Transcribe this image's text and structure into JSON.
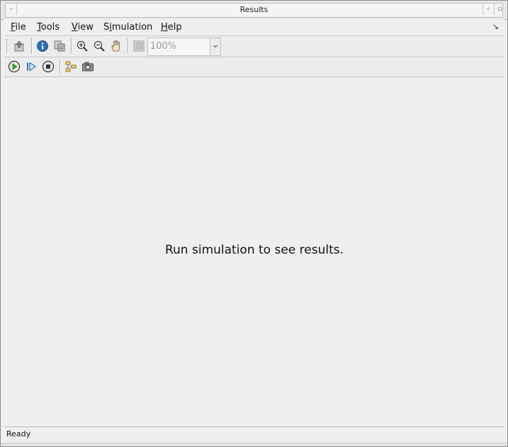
{
  "window": {
    "title": "Results",
    "controls": {
      "menu_icon": "window-menu-icon",
      "shade_icon": "shade-icon",
      "maximize_icon": "maximize-icon"
    }
  },
  "menubar": {
    "items": [
      {
        "label": "File",
        "mnemonic": "F",
        "rest": "ile"
      },
      {
        "label": "Tools",
        "mnemonic": "T",
        "rest": "ools"
      },
      {
        "label": "View",
        "mnemonic": "V",
        "rest": "iew"
      },
      {
        "label": "Simulation",
        "pre": "S",
        "mnemonic": "i",
        "rest": "mulation"
      },
      {
        "label": "Help",
        "mnemonic": "H",
        "rest": "elp"
      }
    ],
    "overflow_icon": "menu-overflow-icon",
    "overflow_glyph": "↘"
  },
  "toolbar1": {
    "icons": [
      "export-icon",
      "info-icon",
      "copy-icon",
      "zoom-in-icon",
      "zoom-out-icon",
      "pan-hand-icon",
      "fit-icon"
    ],
    "zoom_value": "100%"
  },
  "toolbar2": {
    "icons": [
      "run-icon",
      "step-icon",
      "stop-icon",
      "network-icon",
      "camera-icon"
    ]
  },
  "main": {
    "message": "Run simulation to see results."
  },
  "status": {
    "text": "Ready"
  },
  "colors": {
    "accent_green": "#3aa83a",
    "accent_blue": "#2f6fb3",
    "background": "#efefef"
  }
}
